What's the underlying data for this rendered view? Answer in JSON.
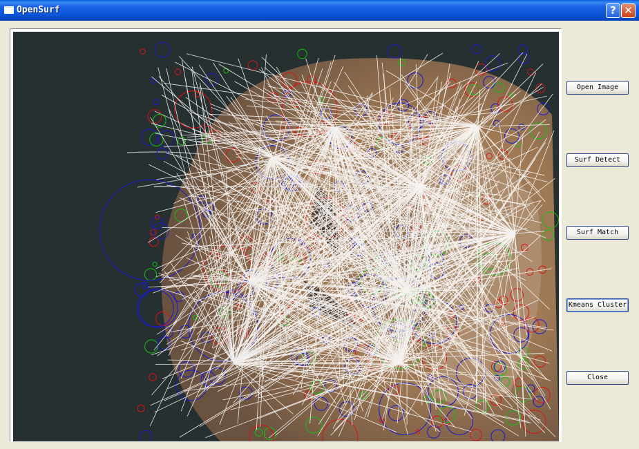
{
  "window": {
    "title": "OpenSurf"
  },
  "titlebar": {
    "help_symbol": "?",
    "close_symbol": "✕"
  },
  "buttons": {
    "open_image": "Open Image",
    "surf_detect": "Surf Detect",
    "surf_match": "Surf Match",
    "kmeans_cluster": "Kmeans Cluster",
    "close": "Close"
  },
  "image": {
    "subject": "tiger-head-with-surf-keypoints"
  },
  "colors": {
    "titlebar": "#0b55d9",
    "background": "#dad7ca",
    "keypoint_red": "#e01010",
    "keypoint_blue": "#1a1ad0",
    "orientation_green": "#10c010",
    "match_lines": "#ffffff"
  }
}
